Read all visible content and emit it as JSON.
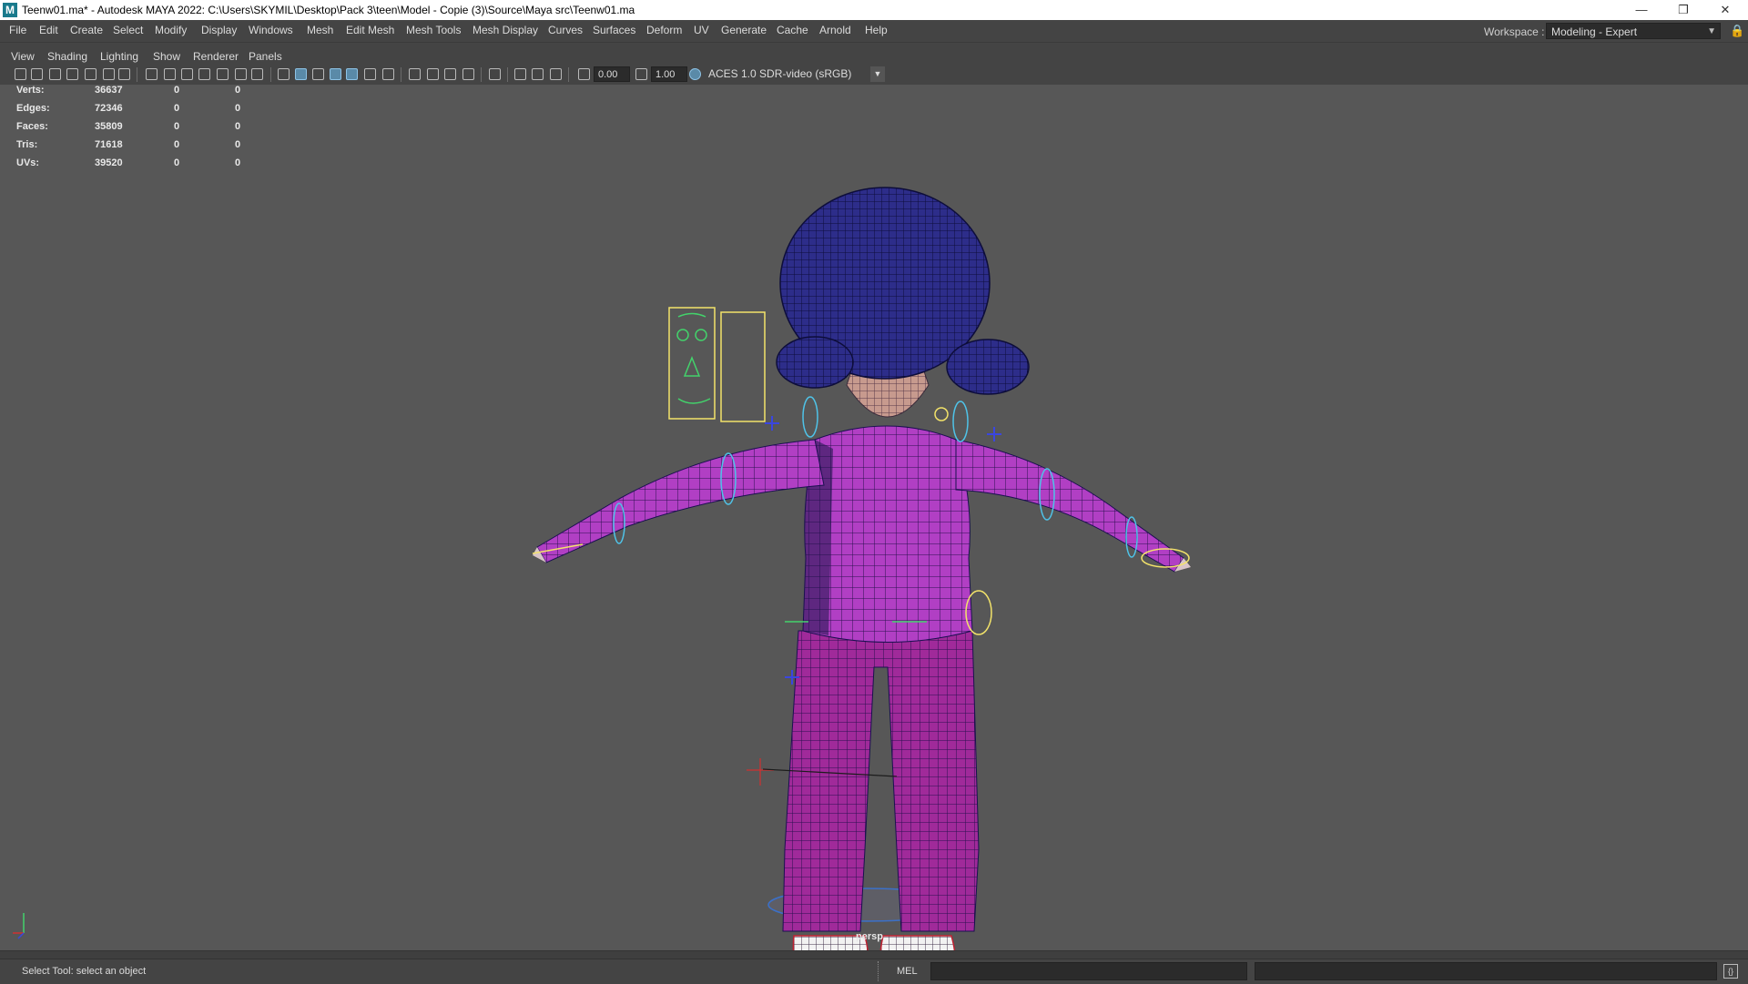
{
  "window": {
    "title": "Teenw01.ma* - Autodesk MAYA 2022: C:\\Users\\SKYMIL\\Desktop\\Pack 3\\teen\\Model - Copie (3)\\Source\\Maya src\\Teenw01.ma",
    "logo_letter": "M",
    "minimize": "—",
    "restore": "❐",
    "close": "✕"
  },
  "menubar": {
    "items": [
      "File",
      "Edit",
      "Create",
      "Select",
      "Modify",
      "Display",
      "Windows",
      "Mesh",
      "Edit Mesh",
      "Mesh Tools",
      "Mesh Display",
      "Curves",
      "Surfaces",
      "Deform",
      "UV",
      "Generate",
      "Cache",
      "Arnold",
      "Help"
    ],
    "workspace_label": "Workspace :",
    "workspace_value": "Modeling - Expert"
  },
  "panel_menu": {
    "items": [
      "View",
      "Shading",
      "Lighting",
      "Show",
      "Renderer",
      "Panels"
    ]
  },
  "viewport_toolbar": {
    "exposure": "0.00",
    "gamma": "1.00",
    "color_space": "ACES 1.0 SDR-video (sRGB)"
  },
  "hud": {
    "rows": [
      {
        "label": "Verts:",
        "a": "36637",
        "b": "0",
        "c": "0"
      },
      {
        "label": "Edges:",
        "a": "72346",
        "b": "0",
        "c": "0"
      },
      {
        "label": "Faces:",
        "a": "35809",
        "b": "0",
        "c": "0"
      },
      {
        "label": "Tris:",
        "a": "71618",
        "b": "0",
        "c": "0"
      },
      {
        "label": "UVs:",
        "a": "39520",
        "b": "0",
        "c": "0"
      }
    ]
  },
  "viewport": {
    "camera": "persp",
    "background_color": "#575757",
    "mesh_color": "#b13fc4",
    "wire_color": "#1a1a6e",
    "control_color": "#4fc3e8"
  },
  "statusbar": {
    "help_line": "Select Tool: select an object",
    "command_language": "MEL"
  }
}
